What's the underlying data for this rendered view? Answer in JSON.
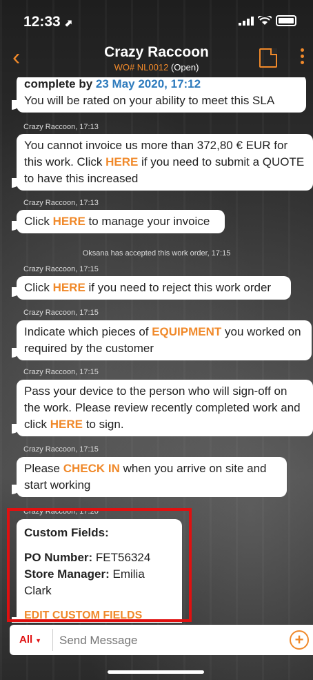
{
  "status": {
    "time": "12:33",
    "arrow": "⬈"
  },
  "header": {
    "back_label": "‹",
    "title": "Crazy Raccoon",
    "wo_number": "WO# NL0012",
    "wo_status": "(Open)"
  },
  "messages": {
    "m0": {
      "l1_pre": "complete by ",
      "date": "23 May 2020, 17:12",
      "l2": "You will be rated on your ability to meet this SLA"
    },
    "s1": "Crazy Raccoon, 17:13",
    "m1": {
      "a": "You cannot invoice us more than 372,80 € EUR for this work. Click ",
      "hl": "HERE",
      "b": " if you need to submit a QUOTE to have this increased"
    },
    "s2": "Crazy Raccoon, 17:13",
    "m2": {
      "a": "Click ",
      "hl": "HERE",
      "b": " to manage your invoice"
    },
    "sys1": "Oksana has accepted this work order, 17:15",
    "s3": "Crazy Raccoon, 17:15",
    "m3": {
      "a": "Click ",
      "hl": "HERE",
      "b": " if you need to reject this work order"
    },
    "s4": "Crazy Raccoon, 17:15",
    "m4": {
      "a": "Indicate which pieces of ",
      "hl": "EQUIPMENT",
      "b": " you worked on required by the customer"
    },
    "s5": "Crazy Raccoon, 17:15",
    "m5": {
      "a": "Pass your device to the person who will sign-off on the work. Please review recently completed work and click ",
      "hl": "HERE",
      "b": " to sign."
    },
    "s6": "Crazy Raccoon, 17:15",
    "m6": {
      "a": "Please ",
      "hl": "CHECK IN",
      "b": " when you arrive on site and start working"
    },
    "s7": "Crazy Raccoon, 17:20",
    "cf": {
      "title": "Custom Fields:",
      "po_label": "PO Number:",
      "po_value": "FET56324",
      "sm_label": "Store Manager:",
      "sm_value": "Emilia Clark",
      "edit": "EDIT CUSTOM FIELDS"
    }
  },
  "composer": {
    "filter": "All",
    "placeholder": "Send Message",
    "plus": "+"
  },
  "colors": {
    "accent": "#f0892a",
    "link_blue": "#2e7bbd",
    "highlight_red": "#e01010"
  }
}
